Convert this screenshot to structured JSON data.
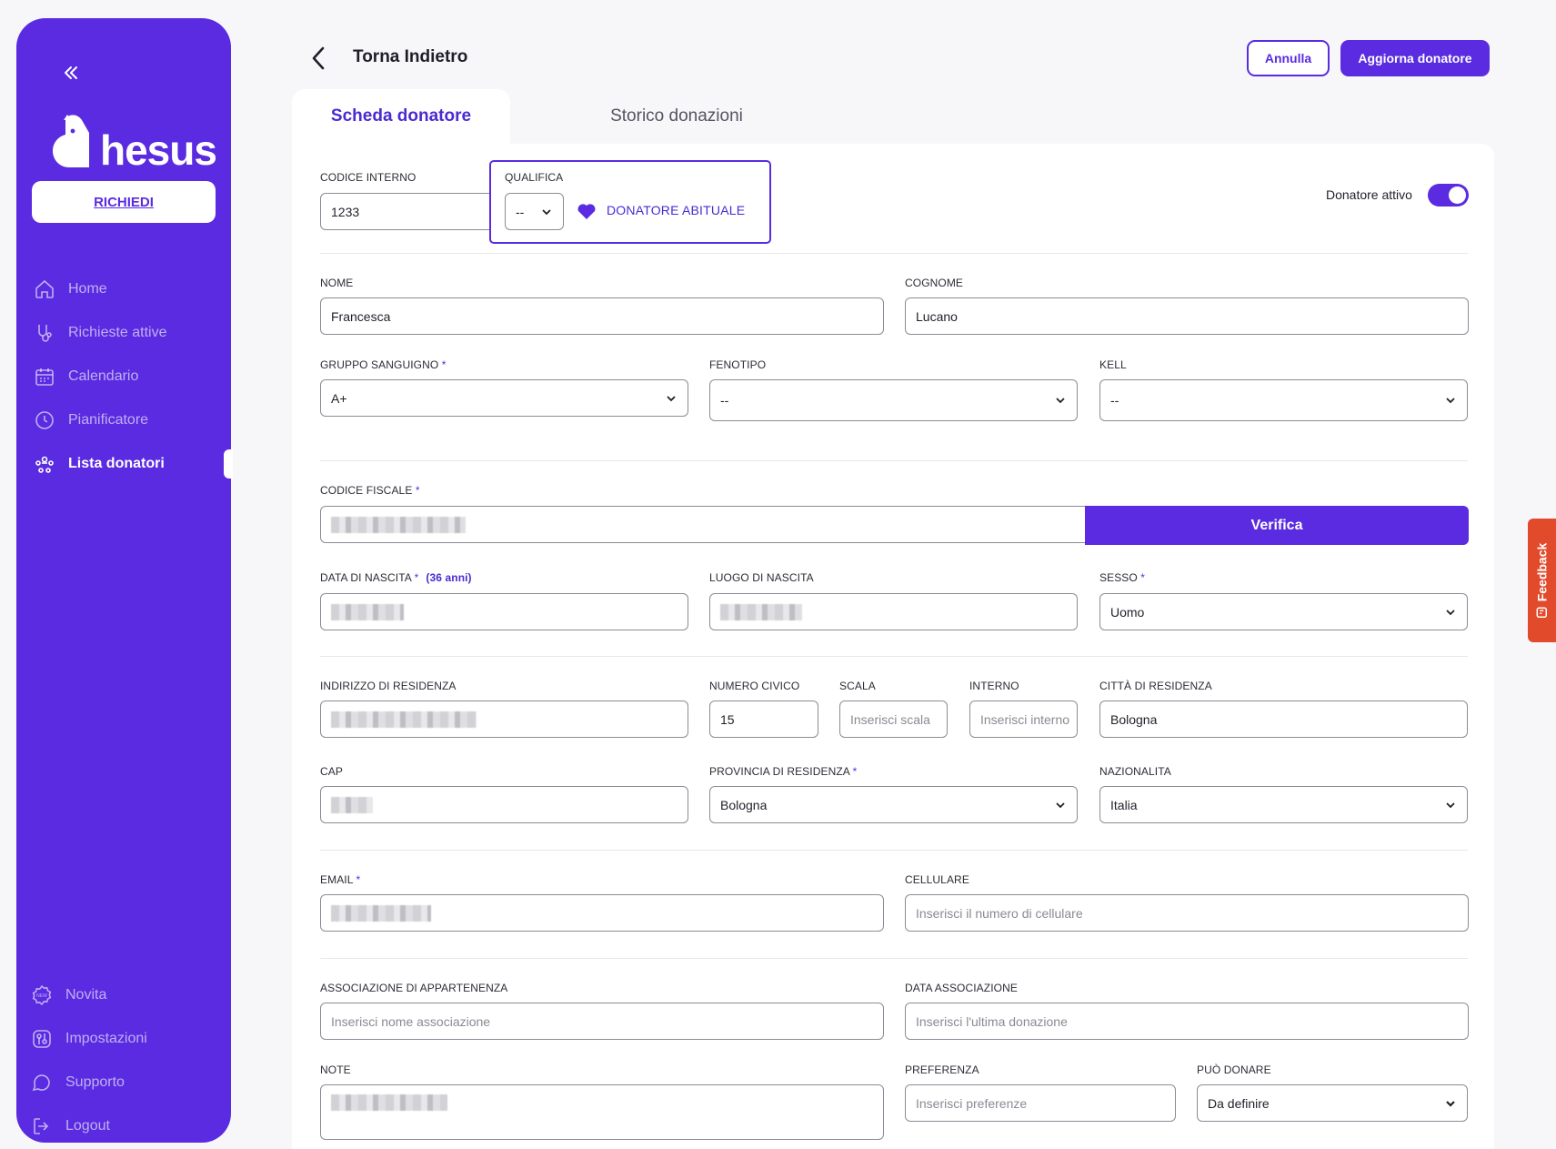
{
  "sidebar": {
    "brand": "hesus",
    "request_button": "RICHIEDI",
    "nav": [
      {
        "label": "Home",
        "icon": "home-icon"
      },
      {
        "label": "Richieste attive",
        "icon": "blood-request-icon"
      },
      {
        "label": "Calendario",
        "icon": "calendar-icon"
      },
      {
        "label": "Pianificatore",
        "icon": "clock-icon"
      },
      {
        "label": "Lista donatori",
        "icon": "donors-icon",
        "active": true
      }
    ],
    "bottom_nav": [
      {
        "label": "Novita",
        "icon": "new-badge-icon"
      },
      {
        "label": "Impostazioni",
        "icon": "settings-icon"
      },
      {
        "label": "Supporto",
        "icon": "support-chat-icon"
      },
      {
        "label": "Logout",
        "icon": "logout-icon"
      }
    ]
  },
  "header": {
    "back_label": "Torna Indietro",
    "cancel_label": "Annulla",
    "update_label": "Aggiorna donatore"
  },
  "tabs": [
    {
      "label": "Scheda donatore",
      "active": true
    },
    {
      "label": "Storico donazioni",
      "active": false
    }
  ],
  "form": {
    "codice_interno": {
      "label": "CODICE INTERNO",
      "value": "1233"
    },
    "qualifica": {
      "label": "QUALIFICA",
      "value": "--",
      "badge": "DONATORE ABITUALE"
    },
    "donatore_attivo": {
      "label": "Donatore attivo",
      "on": true
    },
    "nome": {
      "label": "NOME",
      "value": "Francesca"
    },
    "cognome": {
      "label": "COGNOME",
      "value": "Lucano"
    },
    "gruppo_sanguigno": {
      "label": "GRUPPO SANGUIGNO",
      "value": "A+"
    },
    "fenotipo": {
      "label": "FENOTIPO",
      "value": "--"
    },
    "kell": {
      "label": "KELL",
      "value": "--"
    },
    "codice_fiscale": {
      "label": "CODICE FISCALE",
      "verify_label": "Verifica"
    },
    "data_nascita": {
      "label": "DATA DI NASCITA",
      "age": "(36 anni)"
    },
    "luogo_nascita": {
      "label": "LUOGO DI NASCITA"
    },
    "sesso": {
      "label": "SESSO",
      "value": "Uomo"
    },
    "indirizzo": {
      "label": "INDIRIZZO DI RESIDENZA"
    },
    "numero_civico": {
      "label": "NUMERO CIVICO",
      "value": "15"
    },
    "scala": {
      "label": "SCALA",
      "placeholder": "Inserisci scala"
    },
    "interno": {
      "label": "INTERNO",
      "placeholder": "Inserisci interno"
    },
    "citta": {
      "label": "CITTÀ DI RESIDENZA",
      "value": "Bologna"
    },
    "cap": {
      "label": "CAP"
    },
    "provincia": {
      "label": "PROVINCIA DI RESIDENZA",
      "value": "Bologna"
    },
    "nazionalita": {
      "label": "NAZIONALITA",
      "value": "Italia"
    },
    "email": {
      "label": "EMAIL"
    },
    "cellulare": {
      "label": "CELLULARE",
      "placeholder": "Inserisci il numero di cellulare"
    },
    "associazione": {
      "label": "ASSOCIAZIONE DI APPARTENENZA",
      "placeholder": "Inserisci nome associazione"
    },
    "data_associazione": {
      "label": "DATA ASSOCIAZIONE",
      "placeholder": "Inserisci l'ultima donazione"
    },
    "note": {
      "label": "NOTE"
    },
    "preferenza": {
      "label": "PREFERENZA",
      "placeholder": "Inserisci preferenze"
    },
    "puo_donare": {
      "label": "PUÒ DONARE",
      "value": "Da definire"
    }
  },
  "feedback_label": "Feedback",
  "colors": {
    "primary": "#5a2be0",
    "feedback": "#e24a2c",
    "background": "#f7f7fa"
  }
}
